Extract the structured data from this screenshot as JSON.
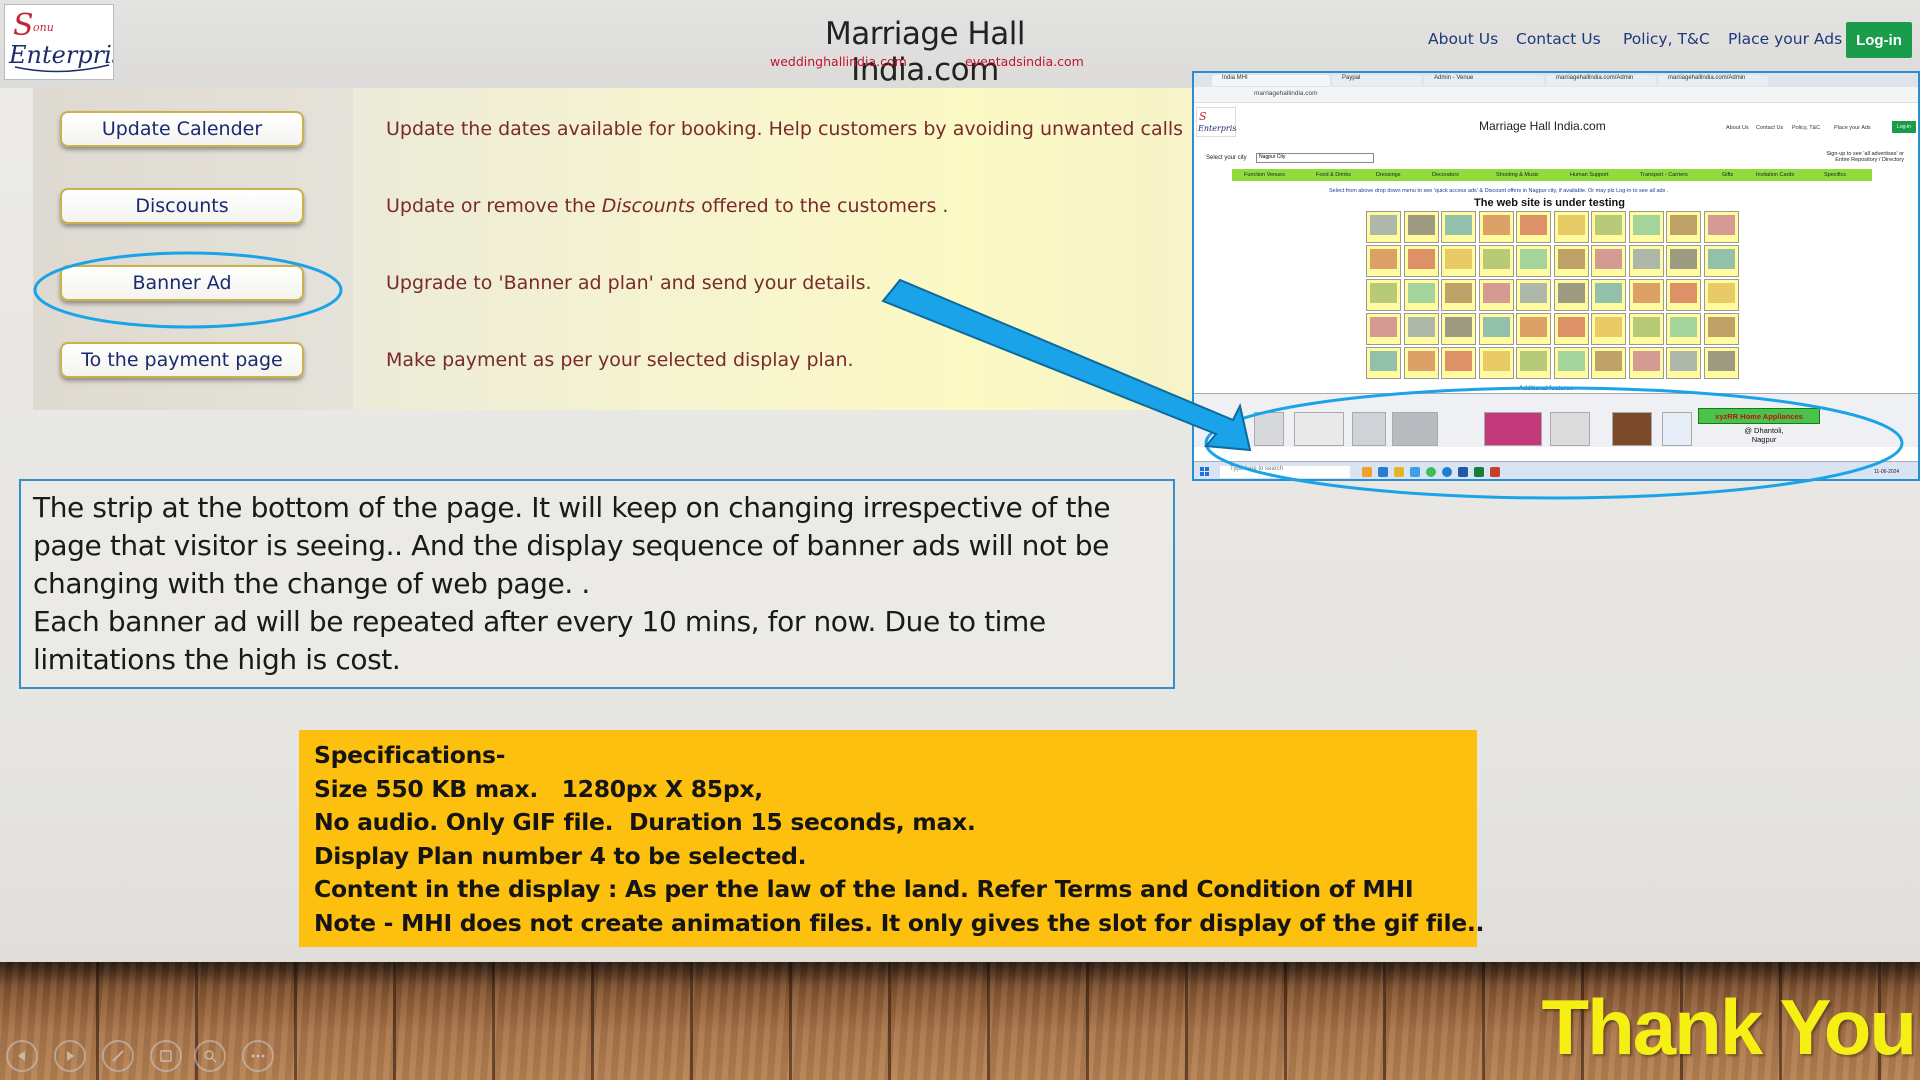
{
  "header": {
    "logo_text": "Sonu Enterprises",
    "title": "Marriage Hall India.com",
    "sub_left": "weddinghallindia.com",
    "sub_right": "eventadsindia.com",
    "nav": [
      "About Us",
      "Contact Us",
      "Policy, T&C",
      "Place your Ads"
    ],
    "login": "Log-in"
  },
  "actions": [
    {
      "button": "Update Calender",
      "desc": "Update the dates available for booking. Help customers by avoiding unwanted calls"
    },
    {
      "button": "Discounts",
      "desc_pre": "Update or remove the ",
      "desc_em": "Discounts",
      "desc_post": " offered to the customers ."
    },
    {
      "button": "Banner Ad",
      "desc": "Upgrade to 'Banner ad plan' and send your details."
    },
    {
      "button": "To the payment page",
      "desc": "Make payment as per your selected display plan."
    }
  ],
  "screenshot": {
    "tabs": [
      "India MHI",
      "Paypal",
      "Admin - Venue",
      "marriagehallindia.com/Admin",
      "marriagehallindia.com/Admin"
    ],
    "url": "marriagehallindia.com",
    "title": "Marriage Hall India.com",
    "nav": [
      "About Us",
      "Contact Us",
      "Policy, T&C",
      "Place your Ads"
    ],
    "login": "Log-in",
    "select_label": "Select your city",
    "select_value": "Nagpur City",
    "signup_line1": "Sign-up to see 'all advertises' or",
    "signup_line2": "Entire Repository / Directory",
    "signup_btn": "Sign-up",
    "categories": [
      "Function Venues",
      "Food & Drinks",
      "Dressings",
      "Decorators",
      "Shooting & Music",
      "Human Support",
      "Transport - Carriers",
      "Gifts",
      "Invitation Cards",
      "Specifics"
    ],
    "info": "Select from above drop down menu to see 'quick access ads' & Discount offers in Nagpur city, if available.   Or may plz Log-in to see all ads .",
    "testing": "The web site is under testing",
    "additional": "Additional features-",
    "strip_brand": "xyzRR Home Appliances",
    "strip_loc1": "@ Dhantoli,",
    "strip_loc2": "Nagpur",
    "taskbar_search": "Type here to search",
    "taskbar_time": "11-06-2024"
  },
  "textbox": {
    "line1": "The strip at the bottom of the page. It will keep on changing irrespective of the",
    "line2": "page that visitor is seeing.. And the display sequence of banner ads will not be",
    "line3": "changing with the change of web page. .",
    "line4": "Each banner ad will be repeated after every 10 mins, for now. Due to time",
    "line5": "limitations the high is cost."
  },
  "specs": [
    "Specifications-",
    "Size 550 KB max.   1280px X 85px,",
    "No audio. Only GIF file.  Duration 15 seconds, max.",
    "Display Plan number 4 to be selected.",
    "Content in the display : As per the law of the land. Refer Terms and Condition of MHI",
    "Note - MHI does not create animation files. It only gives the slot for display of the gif file.."
  ],
  "footer": {
    "thank_you": "Thank You"
  },
  "colors": {
    "accent_blue": "#1aa3e8",
    "login_green": "#1a9c4a",
    "specs_bg": "#fec00e",
    "thankyou": "#f5ef14",
    "desc_text": "#7a2a2a"
  },
  "icons": [
    "prev-slide-icon",
    "next-slide-icon",
    "pen-icon",
    "slides-icon",
    "zoom-icon",
    "more-icon"
  ]
}
